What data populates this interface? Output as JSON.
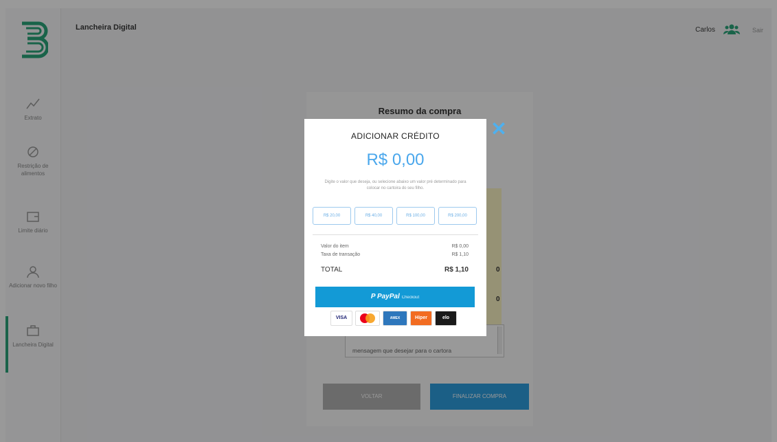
{
  "header": {
    "app_title": "Lancheira Digital",
    "user_name": "Carlos",
    "exit_label": "Sair"
  },
  "sidebar": {
    "items": [
      {
        "label": "Extrato",
        "icon": "chart-line-icon"
      },
      {
        "label": "Restrição de alimentos",
        "icon": "restriction-icon"
      },
      {
        "label": "Limite diário",
        "icon": "wallet-icon"
      },
      {
        "label": "Adicionar novo filho",
        "icon": "add-user-icon"
      },
      {
        "label": "Lancheira Digital",
        "icon": "lunchbox-icon",
        "active": true
      }
    ]
  },
  "summary": {
    "title": "Resumo da compra",
    "value_a": "0",
    "value_b": "0",
    "message_placeholder": "mensagem que desejar para o cartora",
    "back_button": "VOLTAR",
    "finish_button": "FINALIZAR COMPRA"
  },
  "modal": {
    "title": "ADICIONAR CRÉDITO",
    "amount": "R$ 0,00",
    "description": "Digite o valor que deseja, ou selecione abaixo um valor pré determinado para colocar no cartoira do seu filho.",
    "amount_options": [
      "R$ 20,00",
      "R$ 40,00",
      "R$ 100,00",
      "R$ 200,00"
    ],
    "item_value_label": "Valor do item",
    "item_value": "R$ 0,00",
    "fee_label": "Taxa de transação",
    "fee_value": "R$ 1,10",
    "total_label": "TOTAL",
    "total_value": "R$ 1,10",
    "paypal_label": "PayPal",
    "paypal_sub": "Checkout",
    "card_brands": [
      "VISA",
      "Mastercard",
      "American Express",
      "Hiper",
      "elo"
    ]
  },
  "colors": {
    "accent_green": "#2aa67a",
    "accent_blue": "#4aa7ec",
    "paypal_blue": "#139ad6"
  }
}
